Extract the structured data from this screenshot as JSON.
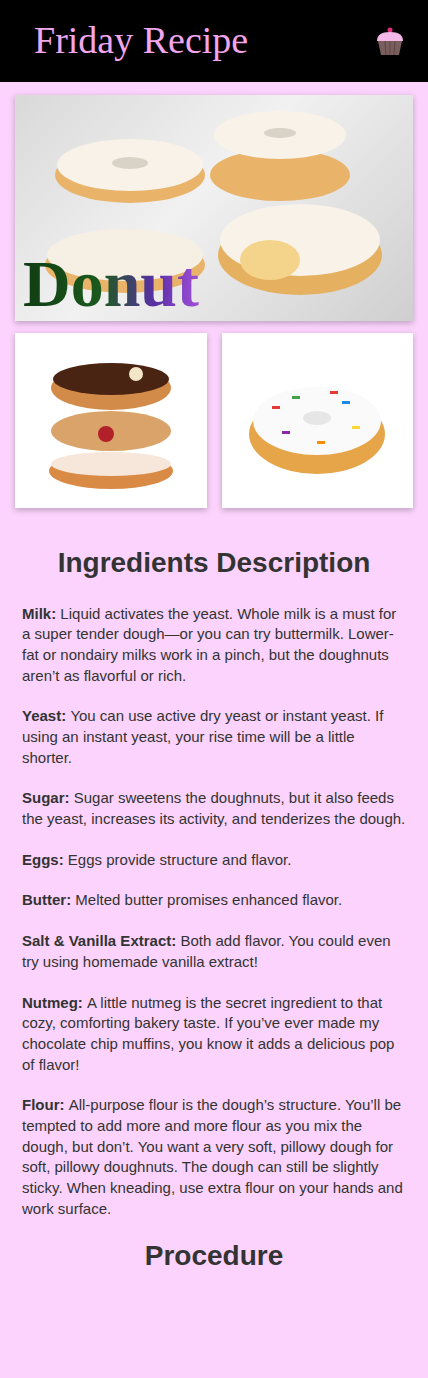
{
  "header": {
    "title": "Friday Recipe"
  },
  "hero": {
    "title": "Donut"
  },
  "ingredients": {
    "heading": "Ingredients Description",
    "items": [
      {
        "label": "Milk:",
        "text": "Liquid activates the yeast. Whole milk is a must for a super tender dough—or you can try buttermilk. Lower-fat or nondairy milks work in a pinch, but the doughnuts aren’t as flavorful or rich."
      },
      {
        "label": "Yeast:",
        "text": "You can use active dry yeast or instant yeast. If using an instant yeast, your rise time will be a little shorter."
      },
      {
        "label": "Sugar:",
        "text": "Sugar sweetens the doughnuts, but it also feeds the yeast, increases its activity, and tenderizes the dough."
      },
      {
        "label": "Eggs:",
        "text": "Eggs provide structure and flavor."
      },
      {
        "label": "Butter:",
        "text": "Melted butter promises enhanced flavor."
      },
      {
        "label": "Salt & Vanilla Extract:",
        "text": "Both add flavor. You could even try using homemade vanilla extract!"
      },
      {
        "label": "Nutmeg:",
        "text": "A little nutmeg is the secret ingredient to that cozy, comforting bakery taste. If you’ve ever made my chocolate chip muffins, you know it adds a delicious pop of flavor!"
      },
      {
        "label": "Flour:",
        "text": "All-purpose flour is the dough’s structure. You’ll be tempted to add more and more flour as you mix the dough, but don’t. You want a very soft, pillowy dough for soft, pillowy doughnuts. The dough can still be slightly sticky. When kneading, use extra flour on your hands and work surface."
      }
    ]
  },
  "procedure": {
    "heading": "Procedure"
  }
}
